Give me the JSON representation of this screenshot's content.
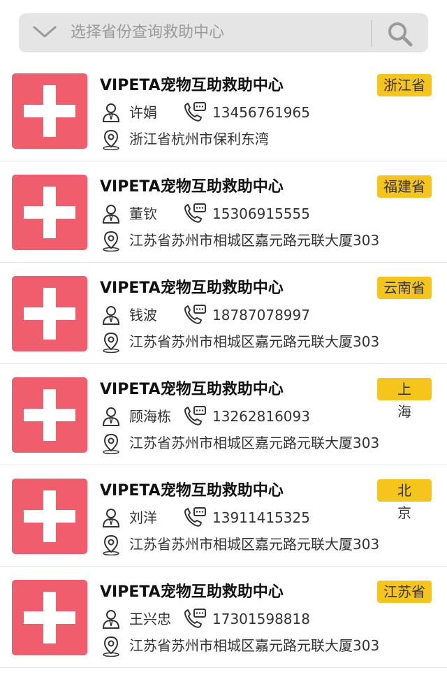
{
  "search": {
    "placeholder": "选择省份查询救助中心"
  },
  "items": [
    {
      "title": "VIPETA宠物互助救助中心",
      "province": "浙江省",
      "name": "许娟",
      "phone": "13456761965",
      "address": "浙江省杭州市保利东湾"
    },
    {
      "title": "VIPETA宠物互助救助中心",
      "province": "福建省",
      "name": "董钦",
      "phone": "15306915555",
      "address": "江苏省苏州市相城区嘉元路元联大厦303"
    },
    {
      "title": "VIPETA宠物互助救助中心",
      "province": "云南省",
      "name": "钱波",
      "phone": "18787078997",
      "address": "江苏省苏州市相城区嘉元路元联大厦303"
    },
    {
      "title": "VIPETA宠物互助救助中心",
      "province": "上海",
      "name": "顾海栋",
      "phone": "13262816093",
      "address": "江苏省苏州市相城区嘉元路元联大厦303"
    },
    {
      "title": "VIPETA宠物互助救助中心",
      "province": "北京",
      "name": "刘洋",
      "phone": "13911415325",
      "address": "江苏省苏州市相城区嘉元路元联大厦303"
    },
    {
      "title": "VIPETA宠物互助救助中心",
      "province": "江苏省",
      "name": "王兴忠",
      "phone": "17301598818",
      "address": "江苏省苏州市相城区嘉元路元联大厦303"
    }
  ],
  "colors": {
    "logo": "#f05d6d",
    "badge": "#f6c51c"
  }
}
